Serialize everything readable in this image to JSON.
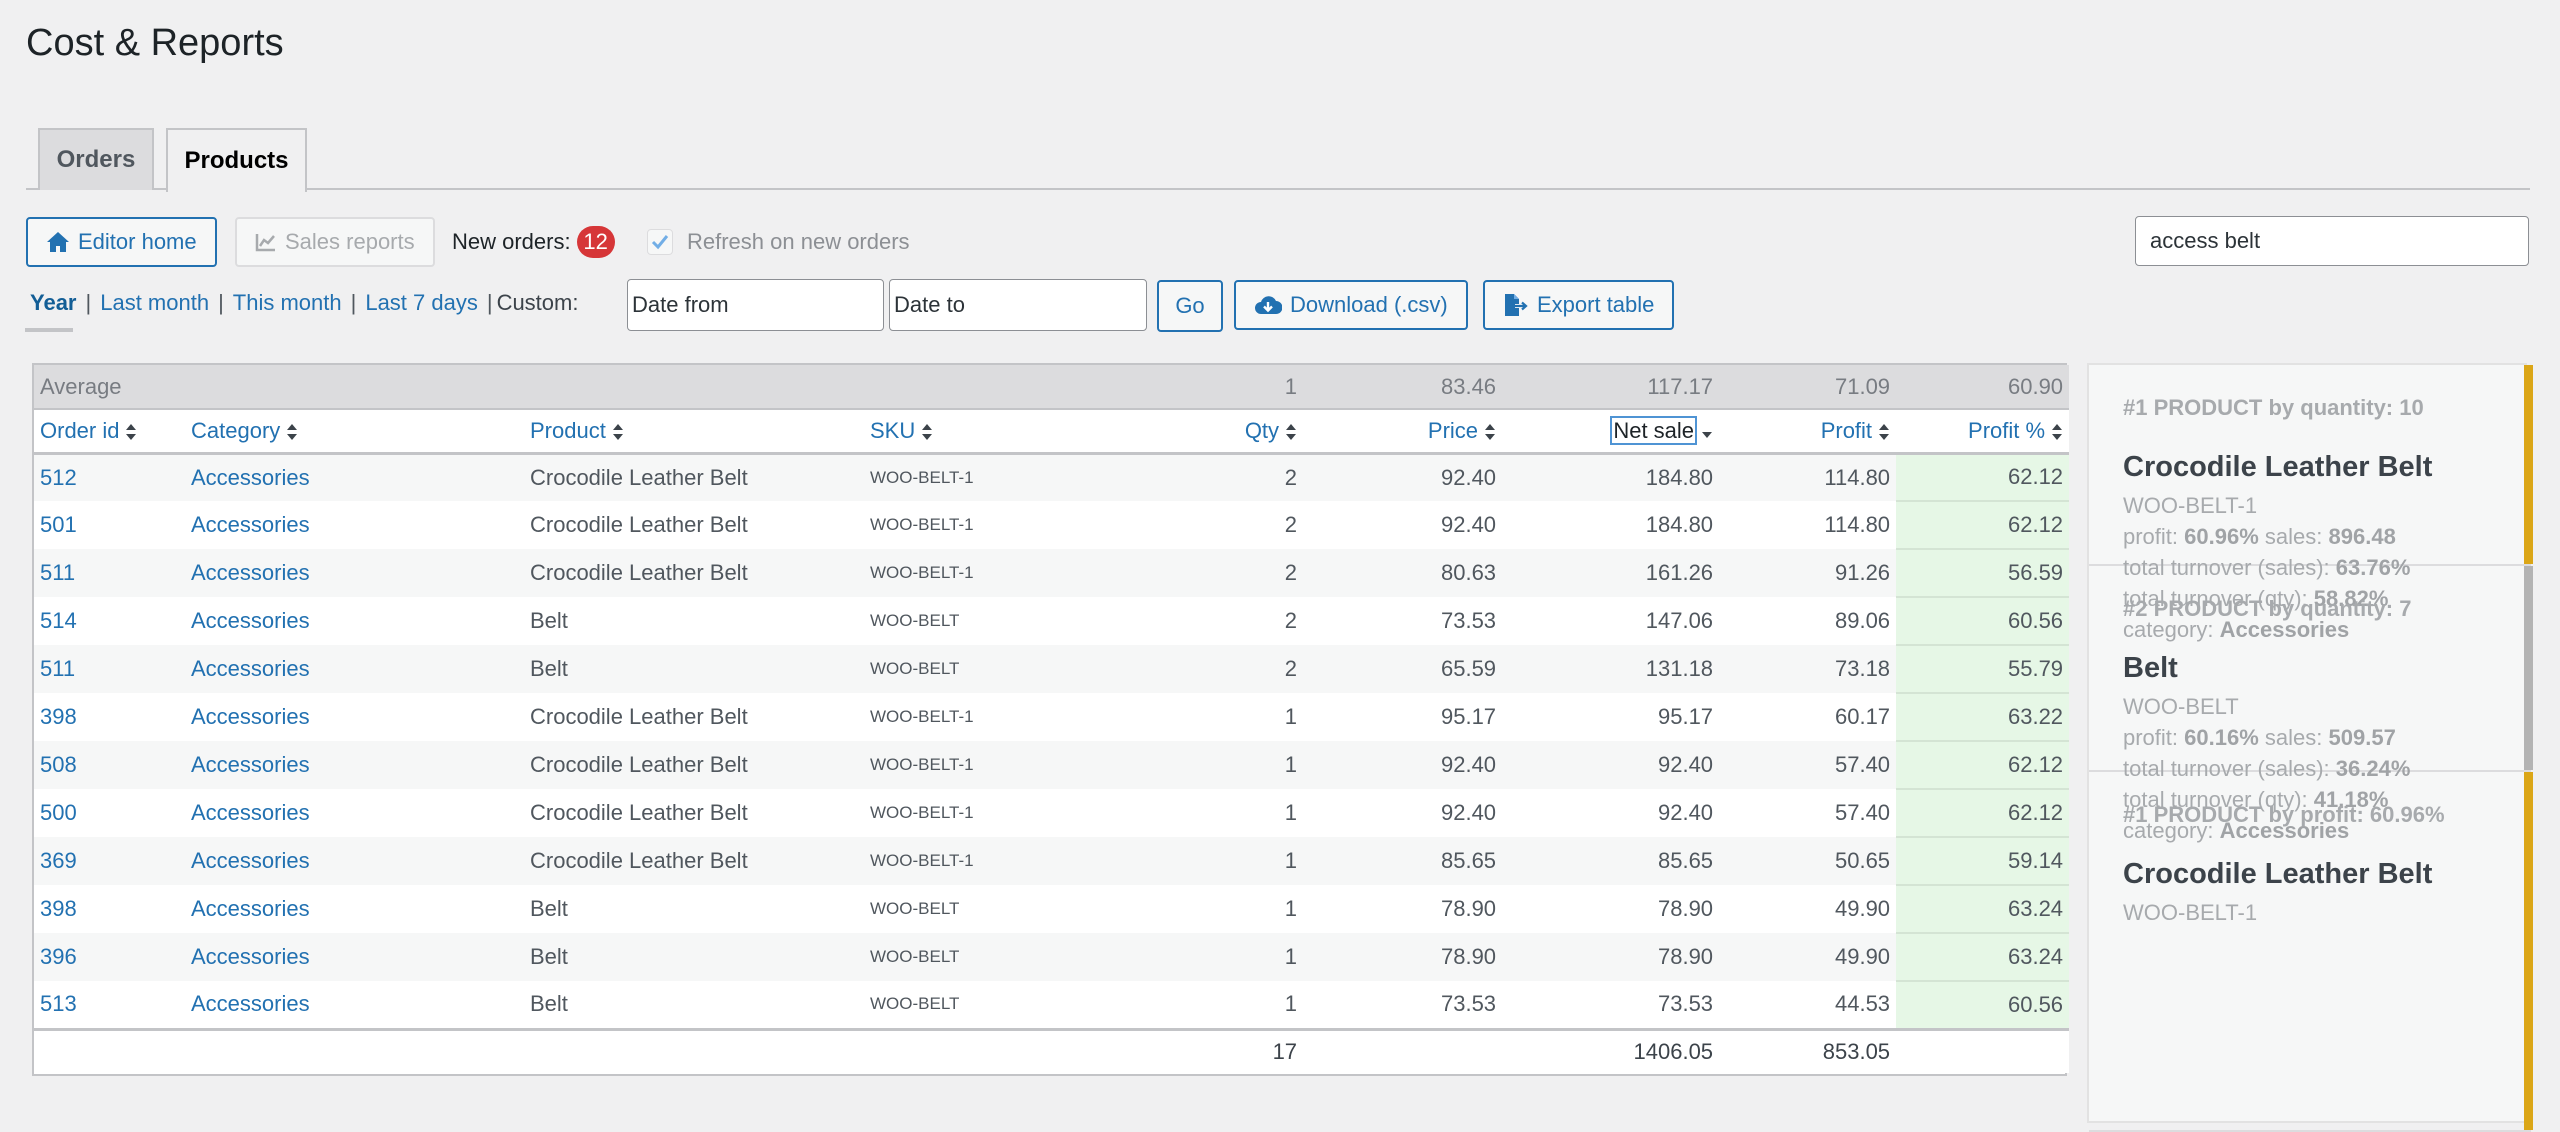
{
  "page": {
    "title": "Cost & Reports"
  },
  "tabs": [
    {
      "label": "Orders",
      "active": false
    },
    {
      "label": "Products",
      "active": true
    }
  ],
  "toolbar": {
    "editor_home_label": "Editor home",
    "sales_reports_label": "Sales reports",
    "new_orders_label": "New orders:",
    "new_orders_count": "12",
    "refresh_label": "Refresh on new orders",
    "refresh_checked": true,
    "search_value": "access belt"
  },
  "periods": {
    "items": [
      "Year",
      "Last month",
      "This month",
      "Last 7 days"
    ],
    "selected": "Year",
    "custom_label": "Custom:",
    "date_from_placeholder": "Date from",
    "date_to_placeholder": "Date to",
    "go_label": "Go",
    "download_label": "Download (.csv)",
    "export_label": "Export table"
  },
  "colors": {
    "accent": "#2271b1",
    "badge": "#d63638",
    "profit_pct_bg": "#e6f7e6",
    "rank_gold": "#dba617",
    "rank_gray": "#b3b3b3"
  },
  "table": {
    "average": {
      "label": "Average",
      "qty": "1",
      "price": "83.46",
      "net_sale": "117.17",
      "profit": "71.09",
      "profit_pct": "60.90"
    },
    "columns": [
      {
        "key": "order_id",
        "label": "Order id",
        "sort": "both"
      },
      {
        "key": "category",
        "label": "Category",
        "sort": "both"
      },
      {
        "key": "product",
        "label": "Product",
        "sort": "both"
      },
      {
        "key": "sku",
        "label": "SKU",
        "sort": "both"
      },
      {
        "key": "qty",
        "label": "Qty",
        "sort": "both"
      },
      {
        "key": "price",
        "label": "Price",
        "sort": "both"
      },
      {
        "key": "net_sale",
        "label": "Net sale",
        "sort": "desc"
      },
      {
        "key": "profit",
        "label": "Profit",
        "sort": "both"
      },
      {
        "key": "profit_pct",
        "label": "Profit %",
        "sort": "both"
      }
    ],
    "rows": [
      {
        "order_id": "512",
        "category": "Accessories",
        "product": "Crocodile Leather Belt",
        "sku": "WOO-BELT-1",
        "qty": "2",
        "price": "92.40",
        "net_sale": "184.80",
        "profit": "114.80",
        "profit_pct": "62.12"
      },
      {
        "order_id": "501",
        "category": "Accessories",
        "product": "Crocodile Leather Belt",
        "sku": "WOO-BELT-1",
        "qty": "2",
        "price": "92.40",
        "net_sale": "184.80",
        "profit": "114.80",
        "profit_pct": "62.12"
      },
      {
        "order_id": "511",
        "category": "Accessories",
        "product": "Crocodile Leather Belt",
        "sku": "WOO-BELT-1",
        "qty": "2",
        "price": "80.63",
        "net_sale": "161.26",
        "profit": "91.26",
        "profit_pct": "56.59"
      },
      {
        "order_id": "514",
        "category": "Accessories",
        "product": "Belt",
        "sku": "WOO-BELT",
        "qty": "2",
        "price": "73.53",
        "net_sale": "147.06",
        "profit": "89.06",
        "profit_pct": "60.56"
      },
      {
        "order_id": "511",
        "category": "Accessories",
        "product": "Belt",
        "sku": "WOO-BELT",
        "qty": "2",
        "price": "65.59",
        "net_sale": "131.18",
        "profit": "73.18",
        "profit_pct": "55.79"
      },
      {
        "order_id": "398",
        "category": "Accessories",
        "product": "Crocodile Leather Belt",
        "sku": "WOO-BELT-1",
        "qty": "1",
        "price": "95.17",
        "net_sale": "95.17",
        "profit": "60.17",
        "profit_pct": "63.22"
      },
      {
        "order_id": "508",
        "category": "Accessories",
        "product": "Crocodile Leather Belt",
        "sku": "WOO-BELT-1",
        "qty": "1",
        "price": "92.40",
        "net_sale": "92.40",
        "profit": "57.40",
        "profit_pct": "62.12"
      },
      {
        "order_id": "500",
        "category": "Accessories",
        "product": "Crocodile Leather Belt",
        "sku": "WOO-BELT-1",
        "qty": "1",
        "price": "92.40",
        "net_sale": "92.40",
        "profit": "57.40",
        "profit_pct": "62.12"
      },
      {
        "order_id": "369",
        "category": "Accessories",
        "product": "Crocodile Leather Belt",
        "sku": "WOO-BELT-1",
        "qty": "1",
        "price": "85.65",
        "net_sale": "85.65",
        "profit": "50.65",
        "profit_pct": "59.14"
      },
      {
        "order_id": "398",
        "category": "Accessories",
        "product": "Belt",
        "sku": "WOO-BELT",
        "qty": "1",
        "price": "78.90",
        "net_sale": "78.90",
        "profit": "49.90",
        "profit_pct": "63.24"
      },
      {
        "order_id": "396",
        "category": "Accessories",
        "product": "Belt",
        "sku": "WOO-BELT",
        "qty": "1",
        "price": "78.90",
        "net_sale": "78.90",
        "profit": "49.90",
        "profit_pct": "63.24"
      },
      {
        "order_id": "513",
        "category": "Accessories",
        "product": "Belt",
        "sku": "WOO-BELT",
        "qty": "1",
        "price": "73.53",
        "net_sale": "73.53",
        "profit": "44.53",
        "profit_pct": "60.56"
      }
    ],
    "totals": {
      "qty": "17",
      "net_sale": "1406.05",
      "profit": "853.05"
    }
  },
  "sidebar": {
    "cards": [
      {
        "rank": "#1 PRODUCT by quantity: 10",
        "name": "Crocodile Leather Belt",
        "sku": "WOO-BELT-1",
        "profit_label": "profit:",
        "profit": "60.96%",
        "sales_label": "sales:",
        "sales": "896.48",
        "turnover_sales_label": "total turnover (sales):",
        "turnover_sales": "63.76%",
        "turnover_qty_label": "total turnover (qty):",
        "turnover_qty": "58.82%",
        "category_label": "category:",
        "category": "Accessories",
        "accent": "gold"
      },
      {
        "rank": "#2 PRODUCT by quantity: 7",
        "name": "Belt",
        "sku": "WOO-BELT",
        "profit_label": "profit:",
        "profit": "60.16%",
        "sales_label": "sales:",
        "sales": "509.57",
        "turnover_sales_label": "total turnover (sales):",
        "turnover_sales": "36.24%",
        "turnover_qty_label": "total turnover (qty):",
        "turnover_qty": "41.18%",
        "category_label": "category:",
        "category": "Accessories",
        "accent": "gray"
      },
      {
        "rank": "#1 PRODUCT by profit: 60.96%",
        "name": "Crocodile Leather Belt",
        "sku": "WOO-BELT-1",
        "accent": "gold"
      }
    ]
  }
}
